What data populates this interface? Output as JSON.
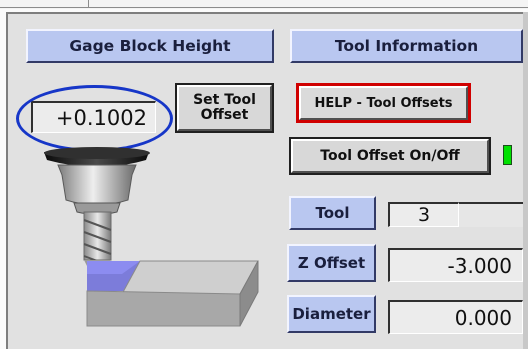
{
  "gage_block": {
    "header": "Gage Block Height",
    "value": "+0.1002",
    "set_tool_offset_label": "Set Tool\nOffset"
  },
  "tool_info": {
    "header": "Tool Information",
    "help_button": "HELP - Tool Offsets",
    "toggle_button": "Tool Offset On/Off",
    "led_state": "on",
    "led_color": "#00e000",
    "fields": [
      {
        "label": "Tool",
        "value": "3"
      },
      {
        "label": "Z Offset",
        "value": "-3.000"
      },
      {
        "label": "Diameter",
        "value": "0.000"
      }
    ]
  },
  "colors": {
    "header_bg": "#b9c7f0",
    "highlight_oval": "#1636c8",
    "help_outline": "#d00000"
  }
}
